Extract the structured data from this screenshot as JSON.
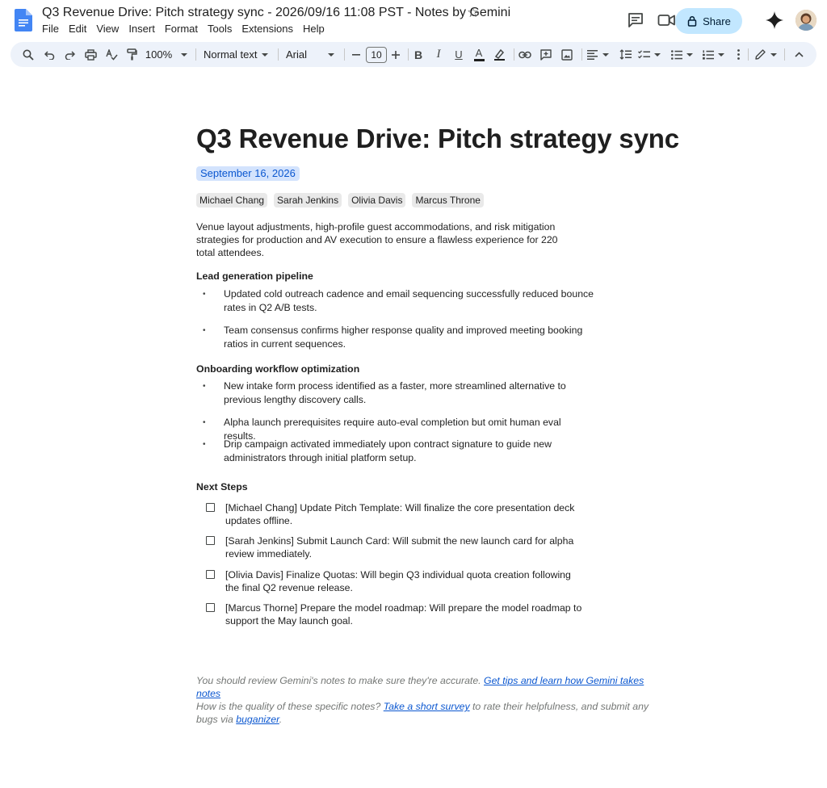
{
  "header": {
    "title": "Q3 Revenue Drive: Pitch strategy sync - 2026/09/16 11:08 PST - Notes by Gemini",
    "menu": [
      "File",
      "Edit",
      "View",
      "Insert",
      "Format",
      "Tools",
      "Extensions",
      "Help"
    ],
    "share_label": "Share"
  },
  "toolbar": {
    "zoom": "100%",
    "style": "Normal text",
    "font": "Arial",
    "font_size": "10"
  },
  "doc": {
    "heading": "Q3 Revenue Drive: Pitch strategy sync",
    "date": "September 16, 2026",
    "attendees": [
      "Michael Chang",
      "Sarah Jenkins",
      "Olivia Davis",
      "Marcus Throne"
    ],
    "summary": "Venue layout adjustments, high-profile guest accommodations, and risk mitigation strategies for production and AV execution to ensure a flawless experience for 220 total attendees.",
    "sections": [
      {
        "title": "Lead generation pipeline",
        "bullets": [
          "Updated cold outreach cadence and email sequencing successfully reduced bounce rates in Q2 A/B tests.",
          "Team consensus confirms higher response quality and improved meeting booking ratios in current sequences."
        ]
      },
      {
        "title": "Onboarding workflow optimization",
        "bullets": [
          "New intake form process identified as a faster, more streamlined alternative to previous lengthy discovery calls.",
          "Alpha launch prerequisites require auto-eval completion but omit human eval results.",
          "Drip campaign activated immediately upon contract signature to guide new administrators through initial platform setup."
        ]
      }
    ],
    "next_steps_title": "Next Steps",
    "next_steps": [
      "[Michael Chang] Update Pitch Template: Will finalize the core presentation deck updates offline.",
      "[Sarah Jenkins] Submit Launch Card: Will submit the new launch card for alpha review immediately.",
      "[Olivia Davis] Finalize Quotas: Will begin Q3 individual quota creation following the final Q2 revenue release.",
      "[Marcus Thorne] Prepare the model roadmap:  Will prepare the model roadmap to support the May launch goal."
    ]
  },
  "footer": {
    "review_text": "You should review Gemini's notes to make sure they're accurate.",
    "tips_link": "Get tips and learn how Gemini takes notes",
    "quality_text": "How is the quality of these specific notes?",
    "survey_link": "Take a short survey",
    "rate_text": "to rate their helpfulness, and submit any bugs via",
    "buganizer_link": "buganizer",
    "period": "."
  },
  "colors": {
    "accent": "#0b57d0",
    "share_bg": "#c2e7ff",
    "toolbar_bg": "#edf2fa",
    "date_chip_bg": "#d3e3fd",
    "chip_bg": "#e9e9e9"
  }
}
